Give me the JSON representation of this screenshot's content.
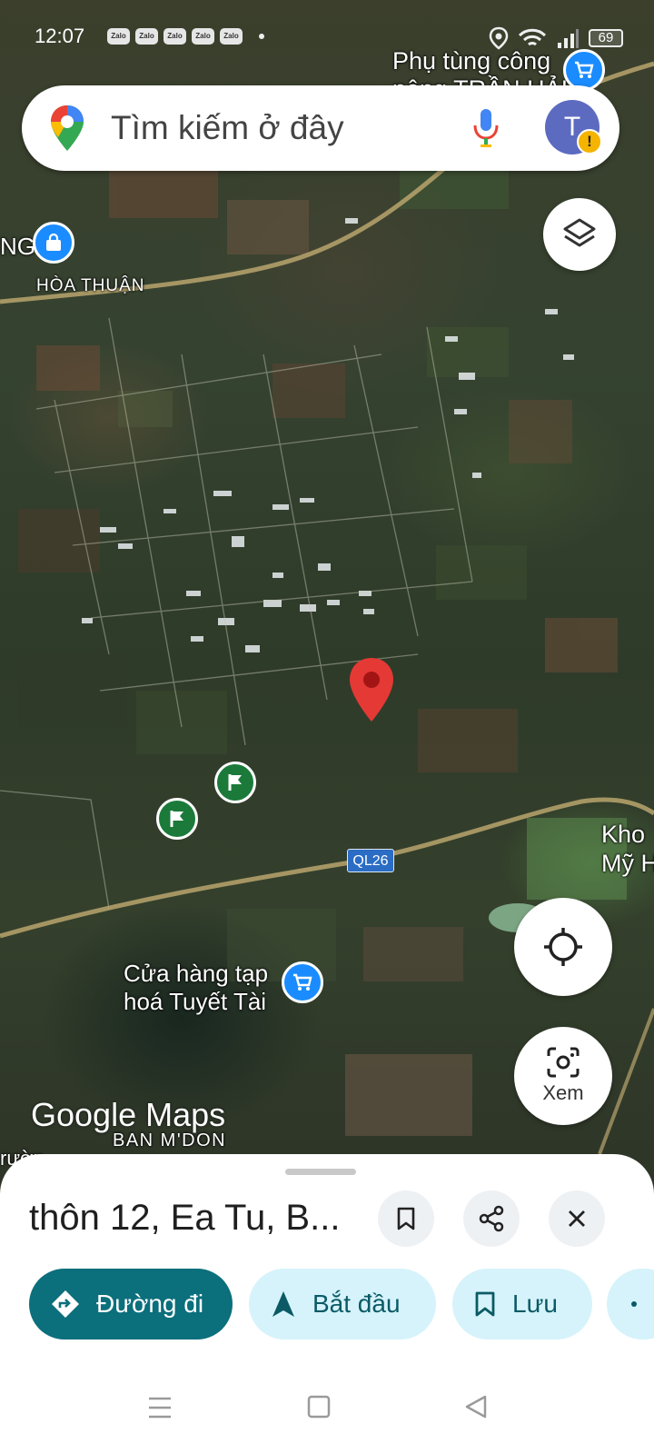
{
  "status_bar": {
    "time": "12:07",
    "notification_apps": [
      "Zalo",
      "Zalo",
      "Zalo",
      "Zalo",
      "Zalo"
    ],
    "battery": "69"
  },
  "search": {
    "placeholder": "Tìm kiếm ở đây",
    "avatar_initial": "T",
    "alert_symbol": "!"
  },
  "map": {
    "labels": {
      "top_business_line1": "Phụ tùng công",
      "top_business_line2": "nông TRẦN HẢI",
      "left_edge": "NG",
      "area_hoa_thuan": "HÒA THUẬN",
      "right_edge_line1": "Kho",
      "right_edge_line2": "Mỹ Hạ",
      "shop_line1": "Cửa hàng tạp",
      "shop_line2": "hoá Tuyết Tài",
      "ban_mdon": "BAN M'DON",
      "bottom_left_edge": "rườn"
    },
    "route_badge": "QL26",
    "watermark": "Google Maps"
  },
  "controls": {
    "view_label": "Xem"
  },
  "place_sheet": {
    "title": "thôn 12, Ea Tu, B...",
    "actions": {
      "directions": "Đường đi",
      "start": "Bắt đầu",
      "save": "Lưu"
    }
  },
  "colors": {
    "primary_chip": "#0b6f7c",
    "secondary_chip": "#d6f3fb",
    "pin_red": "#e53935",
    "poi_blue": "#1a8cff",
    "poi_green": "#1b7a3a"
  }
}
